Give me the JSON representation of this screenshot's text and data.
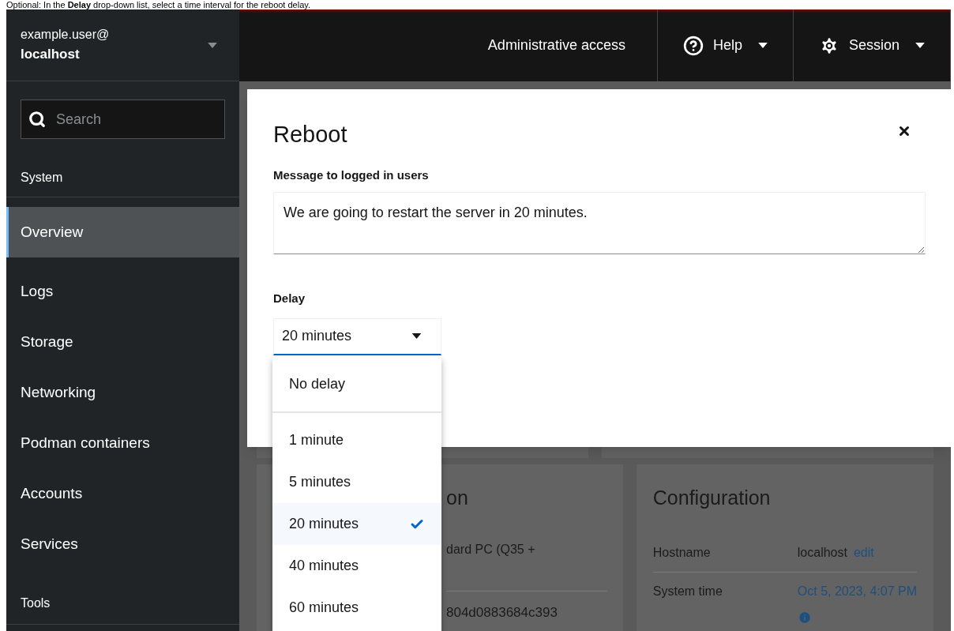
{
  "caption": "Optional: In the **Delay** drop-down list, select a time interval for the reboot delay.",
  "header": {
    "user": "example.user@",
    "host": "localhost",
    "items": [
      {
        "label": "Administrative access",
        "kind": "plain"
      },
      {
        "label": "Help",
        "kind": "help"
      },
      {
        "label": "Session",
        "kind": "session"
      }
    ]
  },
  "sidebar": {
    "search": {
      "placeholder": "Search"
    },
    "section_title": "System",
    "items": [
      {
        "label": "Overview",
        "selected": true
      },
      {
        "label": "Logs",
        "selected": false
      },
      {
        "label": "Storage",
        "selected": false
      },
      {
        "label": "Networking",
        "selected": false
      },
      {
        "label": "Podman containers",
        "selected": false
      },
      {
        "label": "Accounts",
        "selected": false
      },
      {
        "label": "Services",
        "selected": false
      }
    ],
    "tools_title": "Tools"
  },
  "left_card": {
    "title": "on",
    "rows": [
      "dard PC (Q35 +",
      "804d0883684c393"
    ]
  },
  "right_card": {
    "title": "Configuration",
    "rows": [
      {
        "label": "Hostname",
        "value": "localhost",
        "link": "edit"
      },
      {
        "label": "System time",
        "link": "Oct 5, 2023, 4:07 PM",
        "info": true
      }
    ]
  },
  "dialog": {
    "title": "Reboot",
    "message_label": "Message to logged in users",
    "message": "We are going to restart the server in 20 minutes.",
    "delay_label": "Delay",
    "delay_value": "20 minutes",
    "expanded": true,
    "option_groups": [
      [
        {
          "label": "No delay",
          "selected": false
        }
      ],
      [
        {
          "label": "1 minute",
          "selected": false
        },
        {
          "label": "5 minutes",
          "selected": false
        },
        {
          "label": "20 minutes",
          "selected": true
        },
        {
          "label": "40 minutes",
          "selected": false
        },
        {
          "label": "60 minutes",
          "selected": false
        }
      ]
    ]
  }
}
